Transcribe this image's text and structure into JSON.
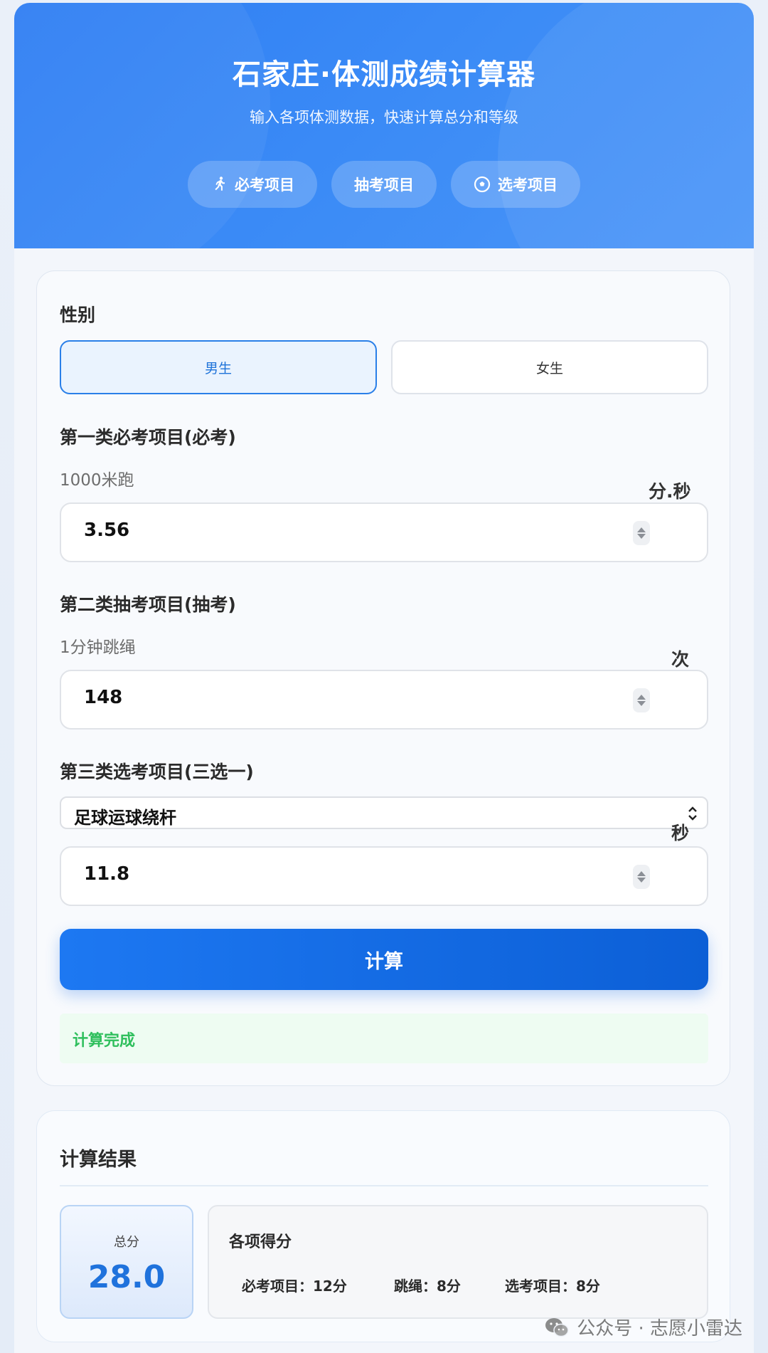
{
  "header": {
    "title": "石家庄·体测成绩计算器",
    "subtitle": "输入各项体测数据，快速计算总分和等级",
    "tabs": [
      {
        "label": "必考项目",
        "icon": "running-icon"
      },
      {
        "label": "抽考项目",
        "icon": ""
      },
      {
        "label": "选考项目",
        "icon": "soccer-ball-icon"
      }
    ]
  },
  "form": {
    "gender_label": "性别",
    "gender_options": [
      "男生",
      "女生"
    ],
    "gender_selected": "男生",
    "cat1": {
      "title": "第一类必考项目(必考)",
      "item": "1000米跑",
      "unit": "分.秒",
      "value": "3.56"
    },
    "cat2": {
      "title": "第二类抽考项目(抽考)",
      "item": "1分钟跳绳",
      "unit": "次",
      "value": "148"
    },
    "cat3": {
      "title": "第三类选考项目(三选一)",
      "selected": "足球运球绕杆",
      "unit": "秒",
      "value": "11.8"
    },
    "calc_button": "计算",
    "status": "计算完成"
  },
  "result": {
    "title": "计算结果",
    "total_label": "总分",
    "total_value": "28.0",
    "items_title": "各项得分",
    "scores": [
      "必考项目：12分",
      "跳绳：8分",
      "选考项目：8分"
    ]
  },
  "watermark": "公众号 · 志愿小雷达",
  "colors": {
    "accent": "#1f72dc",
    "header": "#3b8bf6",
    "success": "#2fbf5d"
  }
}
